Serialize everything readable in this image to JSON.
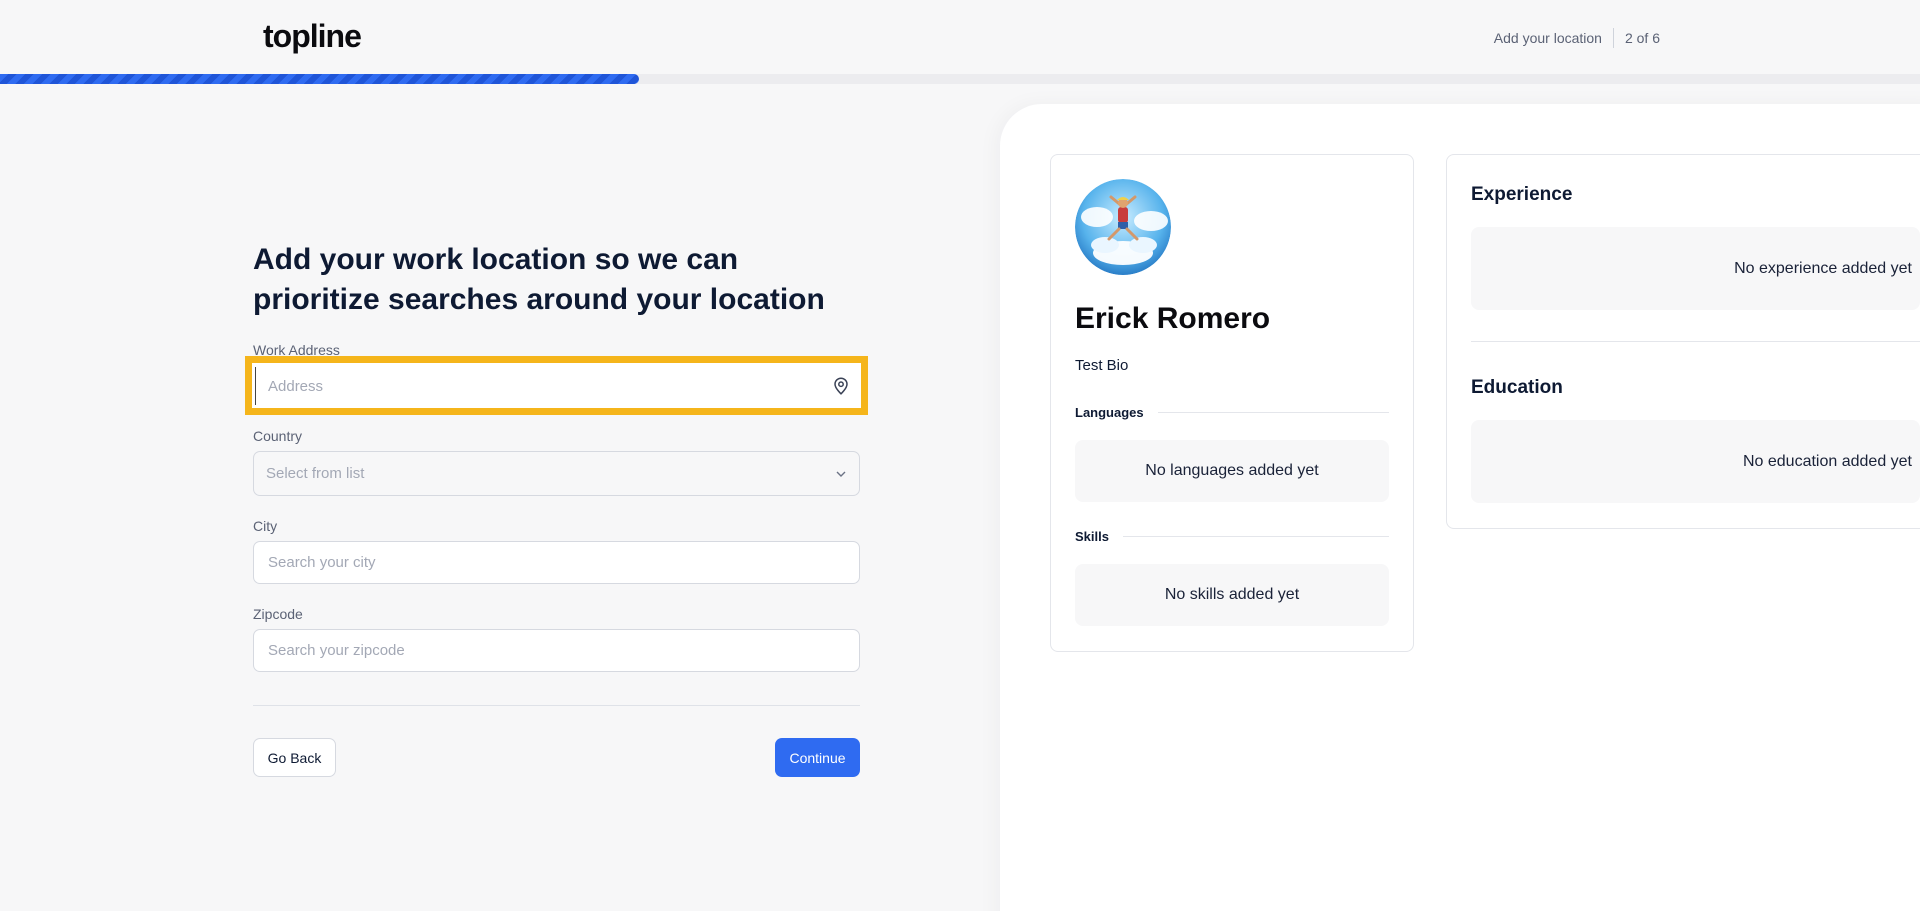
{
  "header": {
    "logo": "topline",
    "step_label": "Add your location",
    "step_count": "2 of 6",
    "progress_fraction": 0.333
  },
  "form": {
    "headline": "Add your work location so we can prioritize searches around your location",
    "work_address": {
      "label": "Work Address",
      "placeholder": "Address"
    },
    "country": {
      "label": "Country",
      "placeholder": "Select from list"
    },
    "city": {
      "label": "City",
      "placeholder": "Search your city"
    },
    "zipcode": {
      "label": "Zipcode",
      "placeholder": "Search your zipcode"
    },
    "back_label": "Go Back",
    "continue_label": "Continue"
  },
  "preview": {
    "name": "Erick Romero",
    "bio": "Test Bio",
    "languages_title": "Languages",
    "languages_empty": "No languages added yet",
    "skills_title": "Skills",
    "skills_empty": "No skills added yet",
    "experience_title": "Experience",
    "experience_empty": "No experience added yet",
    "education_title": "Education",
    "education_empty": "No education added yet"
  },
  "colors": {
    "accent": "#2f6bf1",
    "highlight": "#f5b51b",
    "text": "#0e1a33"
  },
  "icons": [
    "location-pin-icon",
    "chevron-down-icon",
    "avatar-image"
  ]
}
